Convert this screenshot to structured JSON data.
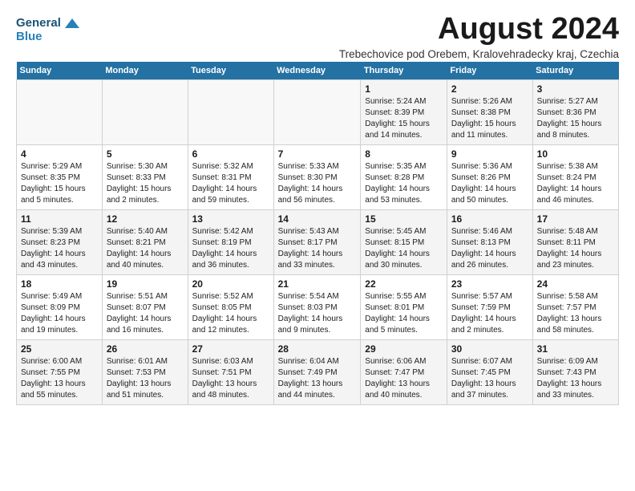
{
  "header": {
    "logo_line1": "General",
    "logo_line2": "Blue",
    "title": "August 2024",
    "subtitle": "Trebechovice pod Orebem, Kralovehradecky kraj, Czechia"
  },
  "weekdays": [
    "Sunday",
    "Monday",
    "Tuesday",
    "Wednesday",
    "Thursday",
    "Friday",
    "Saturday"
  ],
  "weeks": [
    [
      {
        "day": "",
        "info": ""
      },
      {
        "day": "",
        "info": ""
      },
      {
        "day": "",
        "info": ""
      },
      {
        "day": "",
        "info": ""
      },
      {
        "day": "1",
        "info": "Sunrise: 5:24 AM\nSunset: 8:39 PM\nDaylight: 15 hours\nand 14 minutes."
      },
      {
        "day": "2",
        "info": "Sunrise: 5:26 AM\nSunset: 8:38 PM\nDaylight: 15 hours\nand 11 minutes."
      },
      {
        "day": "3",
        "info": "Sunrise: 5:27 AM\nSunset: 8:36 PM\nDaylight: 15 hours\nand 8 minutes."
      }
    ],
    [
      {
        "day": "4",
        "info": "Sunrise: 5:29 AM\nSunset: 8:35 PM\nDaylight: 15 hours\nand 5 minutes."
      },
      {
        "day": "5",
        "info": "Sunrise: 5:30 AM\nSunset: 8:33 PM\nDaylight: 15 hours\nand 2 minutes."
      },
      {
        "day": "6",
        "info": "Sunrise: 5:32 AM\nSunset: 8:31 PM\nDaylight: 14 hours\nand 59 minutes."
      },
      {
        "day": "7",
        "info": "Sunrise: 5:33 AM\nSunset: 8:30 PM\nDaylight: 14 hours\nand 56 minutes."
      },
      {
        "day": "8",
        "info": "Sunrise: 5:35 AM\nSunset: 8:28 PM\nDaylight: 14 hours\nand 53 minutes."
      },
      {
        "day": "9",
        "info": "Sunrise: 5:36 AM\nSunset: 8:26 PM\nDaylight: 14 hours\nand 50 minutes."
      },
      {
        "day": "10",
        "info": "Sunrise: 5:38 AM\nSunset: 8:24 PM\nDaylight: 14 hours\nand 46 minutes."
      }
    ],
    [
      {
        "day": "11",
        "info": "Sunrise: 5:39 AM\nSunset: 8:23 PM\nDaylight: 14 hours\nand 43 minutes."
      },
      {
        "day": "12",
        "info": "Sunrise: 5:40 AM\nSunset: 8:21 PM\nDaylight: 14 hours\nand 40 minutes."
      },
      {
        "day": "13",
        "info": "Sunrise: 5:42 AM\nSunset: 8:19 PM\nDaylight: 14 hours\nand 36 minutes."
      },
      {
        "day": "14",
        "info": "Sunrise: 5:43 AM\nSunset: 8:17 PM\nDaylight: 14 hours\nand 33 minutes."
      },
      {
        "day": "15",
        "info": "Sunrise: 5:45 AM\nSunset: 8:15 PM\nDaylight: 14 hours\nand 30 minutes."
      },
      {
        "day": "16",
        "info": "Sunrise: 5:46 AM\nSunset: 8:13 PM\nDaylight: 14 hours\nand 26 minutes."
      },
      {
        "day": "17",
        "info": "Sunrise: 5:48 AM\nSunset: 8:11 PM\nDaylight: 14 hours\nand 23 minutes."
      }
    ],
    [
      {
        "day": "18",
        "info": "Sunrise: 5:49 AM\nSunset: 8:09 PM\nDaylight: 14 hours\nand 19 minutes."
      },
      {
        "day": "19",
        "info": "Sunrise: 5:51 AM\nSunset: 8:07 PM\nDaylight: 14 hours\nand 16 minutes."
      },
      {
        "day": "20",
        "info": "Sunrise: 5:52 AM\nSunset: 8:05 PM\nDaylight: 14 hours\nand 12 minutes."
      },
      {
        "day": "21",
        "info": "Sunrise: 5:54 AM\nSunset: 8:03 PM\nDaylight: 14 hours\nand 9 minutes."
      },
      {
        "day": "22",
        "info": "Sunrise: 5:55 AM\nSunset: 8:01 PM\nDaylight: 14 hours\nand 5 minutes."
      },
      {
        "day": "23",
        "info": "Sunrise: 5:57 AM\nSunset: 7:59 PM\nDaylight: 14 hours\nand 2 minutes."
      },
      {
        "day": "24",
        "info": "Sunrise: 5:58 AM\nSunset: 7:57 PM\nDaylight: 13 hours\nand 58 minutes."
      }
    ],
    [
      {
        "day": "25",
        "info": "Sunrise: 6:00 AM\nSunset: 7:55 PM\nDaylight: 13 hours\nand 55 minutes."
      },
      {
        "day": "26",
        "info": "Sunrise: 6:01 AM\nSunset: 7:53 PM\nDaylight: 13 hours\nand 51 minutes."
      },
      {
        "day": "27",
        "info": "Sunrise: 6:03 AM\nSunset: 7:51 PM\nDaylight: 13 hours\nand 48 minutes."
      },
      {
        "day": "28",
        "info": "Sunrise: 6:04 AM\nSunset: 7:49 PM\nDaylight: 13 hours\nand 44 minutes."
      },
      {
        "day": "29",
        "info": "Sunrise: 6:06 AM\nSunset: 7:47 PM\nDaylight: 13 hours\nand 40 minutes."
      },
      {
        "day": "30",
        "info": "Sunrise: 6:07 AM\nSunset: 7:45 PM\nDaylight: 13 hours\nand 37 minutes."
      },
      {
        "day": "31",
        "info": "Sunrise: 6:09 AM\nSunset: 7:43 PM\nDaylight: 13 hours\nand 33 minutes."
      }
    ]
  ]
}
